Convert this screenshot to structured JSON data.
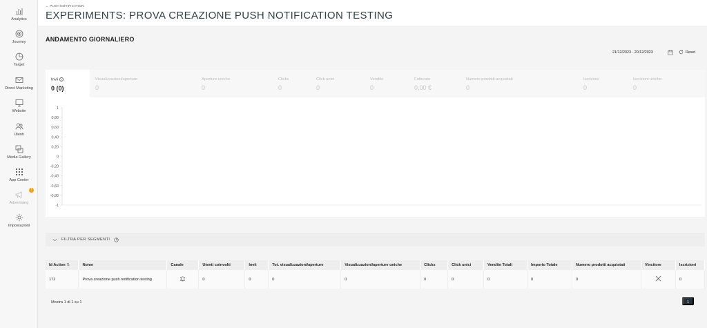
{
  "sidebar": {
    "items": [
      {
        "label": "Analytics",
        "icon": "bar-chart-icon"
      },
      {
        "label": "Journey",
        "icon": "journey-icon"
      },
      {
        "label": "Target",
        "icon": "pie-chart-icon"
      },
      {
        "label": "Direct Marketing",
        "icon": "mail-icon"
      },
      {
        "label": "Website",
        "icon": "monitor-icon"
      },
      {
        "label": "Utenti",
        "icon": "users-icon"
      },
      {
        "label": "Media Gallery",
        "icon": "images-icon"
      },
      {
        "label": "App Center",
        "icon": "apps-grid-icon"
      },
      {
        "label": "Advertising",
        "icon": "megaphone-icon",
        "badge": "!"
      },
      {
        "label": "Impostazioni",
        "icon": "gear-icon"
      }
    ]
  },
  "header": {
    "back_link": "← PUSH NOTIFICATION",
    "title": "EXPERIMENTS: PROVA CREAZIONE PUSH NOTIFICATION TESTING"
  },
  "daily": {
    "title": "ANDAMENTO GIORNALIERO",
    "date_range": "21/12/2023 - 20/12/2023",
    "reset_label": "Reset"
  },
  "kpis": [
    {
      "label": "Invii",
      "value": "0 (0)"
    },
    {
      "label": "Visualizzazioni/aperture",
      "value": "0"
    },
    {
      "label": "Aperture uniche",
      "value": "0"
    },
    {
      "label": "Clicks",
      "value": "0"
    },
    {
      "label": "Click unici",
      "value": "0"
    },
    {
      "label": "Vendite",
      "value": "0"
    },
    {
      "label": "Fatturato",
      "value": "0,00 €"
    },
    {
      "label": "Numero prodotti acquistati",
      "value": "0"
    },
    {
      "label": "Iscrizioni",
      "value": "0"
    },
    {
      "label": "Iscrizioni uniche",
      "value": "0"
    }
  ],
  "chart_data": {
    "type": "line",
    "title": "",
    "xlabel": "",
    "ylabel": "",
    "ylim": [
      -1,
      1
    ],
    "y_ticks": [
      "1",
      "0,80",
      "0,60",
      "0,40",
      "0,20",
      "0",
      "-0,20",
      "-0,40",
      "-0,60",
      "-0,80",
      "-1"
    ],
    "series": []
  },
  "filter": {
    "label": "FILTRA PER SEGMENTI"
  },
  "table": {
    "columns": [
      "Id Action",
      "Nome",
      "Canale",
      "Utenti coinvolti",
      "Invii",
      "Tot. visualizzazioni/aperture",
      "Visualizzazioni/aperture uniche",
      "Clicks",
      "Click unici",
      "Vendite Totali",
      "Importo Totale",
      "Numero prodotti acquistati",
      "Vincitore",
      "Iscrizioni"
    ],
    "rows": [
      {
        "id": "172",
        "nome": "Prova creazione push notification testing",
        "canale_icon": "bell-icon",
        "utenti": "0",
        "invii": "0",
        "tot_vis": "0",
        "vis_uniche": "0",
        "clicks": "0",
        "click_unici": "0",
        "vendite": "0",
        "importo": "0",
        "prodotti": "0",
        "vincitore_icon": "x-icon",
        "iscrizioni": "0"
      }
    ]
  },
  "pagination": {
    "summary": "Mostra 1 di 1 su 1",
    "current_page": "1"
  }
}
